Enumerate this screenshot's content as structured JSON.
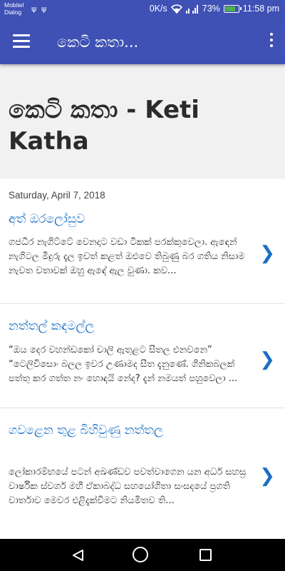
{
  "status_bar": {
    "carrier_line1": "Mobitel",
    "carrier_line2": "Dialog",
    "usb_icon": "usb-icon",
    "net_speed": "0K/s",
    "battery_percent": "73%",
    "time": "11:58 pm"
  },
  "app_bar": {
    "title": "කෙටි කතා...",
    "menu_icon": "hamburger-menu-icon",
    "overflow_icon": "more-vert-icon"
  },
  "blog": {
    "title": "කෙටි කතා - Keti Katha"
  },
  "posts": {
    "date": "Saturday, April 7, 2018",
    "items": [
      {
        "title": "අත් ඔරලෝසුව",
        "snippet": "ගජධීර නැගිට්ටේ වෙනදාට වඩා ටිකක් පරක්කුවෙලා. ඇඳෙන් නැගිටල මිදුරු දැල ඉවත් කළත් ඔළුවෙ තිබුණු බර ගතිය නිසාම නැවත වතාවක් ඔහු ඇඳේ ඇල වුණා. කව..."
      },
      {
        "title": "නත්තල් කඳමල්ල",
        "snippet": "“ඔය දෙර වහන්ඩකෝ චාලි ඇතුළට සීතල එනවනෙ” “ටෙලිවිසොං බලල ඉවර උණාමද සීත දැනුණේ. ගිනිකබලක් පත්තු කර ගත්ත නං හොඳයි නේද? දැන් නමයත් පහුවෙලා ..."
      },
      {
        "title": "ගවළෙන තුළ බිහිවුණු නත්තල",
        "snippet": "ලෝකාරම්භයේ පටන් අඛණ්ඩව පවත්වාගෙන යන අර්ධ සහස්‍ර වාර්ෂික ස්වර්ග මහී ඒකාබද්ධ සහයෝගිතා සංසදයේ ප්‍රගති වාර්තාව මෙවර එළිදැක්වීමට නියමිතව ති..."
      }
    ]
  },
  "nav_bar": {
    "back_icon": "back-triangle-icon",
    "home_icon": "home-circle-icon",
    "recent_icon": "recent-apps-square-icon"
  }
}
